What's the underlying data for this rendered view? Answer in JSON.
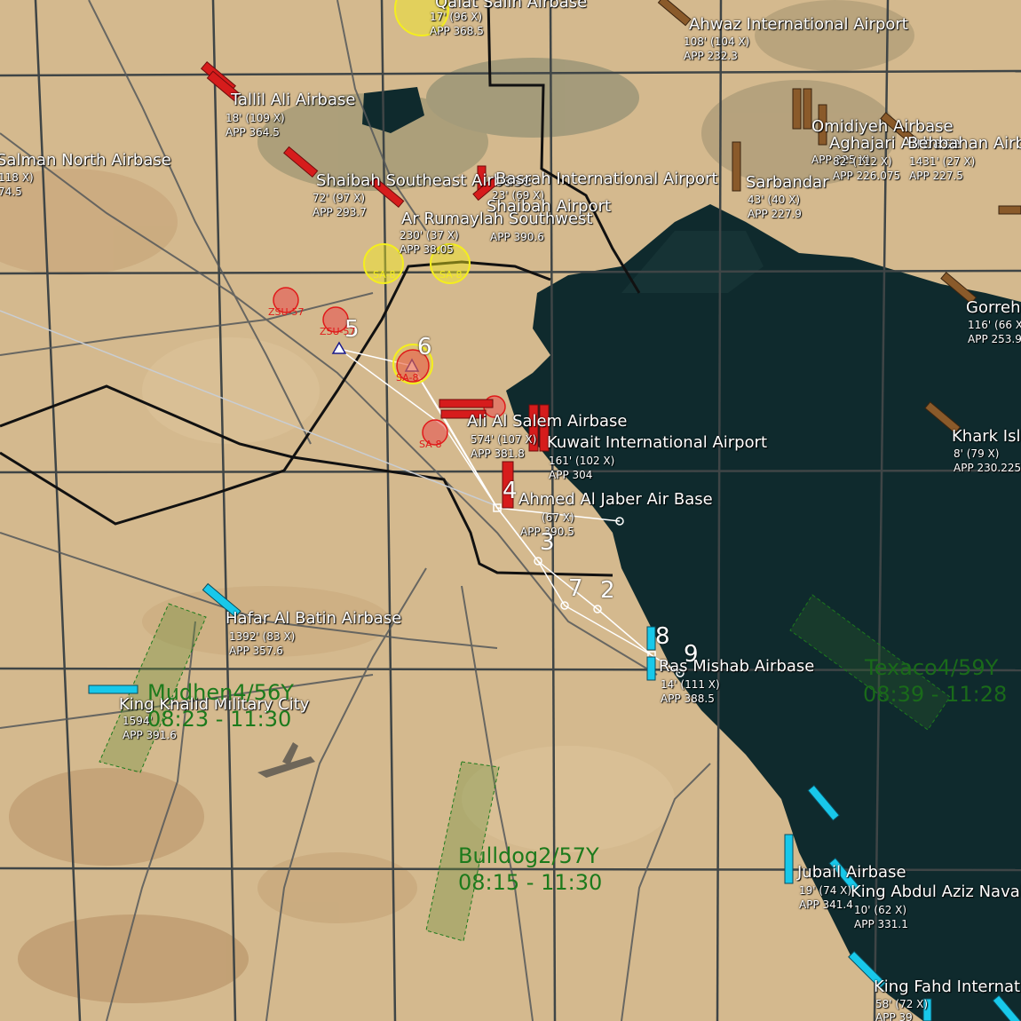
{
  "map": {
    "colors": {
      "land": "#d4b98e",
      "sea": "#0f2a2d",
      "grid": "#3f4546",
      "route": "#ffffff",
      "threat": "#e01a1a",
      "friendly": "#18c8ea",
      "hostile_airbase": "#d61c1c",
      "neutral_airbase": "#8a5a2a",
      "tanker": "#1c7a1c",
      "sam_yellow": "#f4ee1e"
    },
    "airbases": [
      {
        "name": "Salman North Airbase",
        "info1": "118 X)",
        "info2": "74.5"
      },
      {
        "name": "Tallil Ali Airbase",
        "info1": "18' (109 X)",
        "info2": "APP 364.5"
      },
      {
        "name": "Qalat Salih Airbase",
        "info1": "17' (96 X)",
        "info2": "APP 368.5"
      },
      {
        "name": "Ahwaz International Airport",
        "info1": "108' (104 X)",
        "info2": "APP 232.3"
      },
      {
        "name": "Shaibah Southeast Airbase",
        "info1": "72' (97 X)",
        "info2": "APP 293.7"
      },
      {
        "name": "Basrah International Airport",
        "info1": "23' (69 X)",
        "info2": ""
      },
      {
        "name": "Shaibah Airport",
        "info1": "",
        "info2": "APP 390.6"
      },
      {
        "name": "Ar Rumaylah Southwest",
        "info1": "230' (37 X)",
        "info2": "APP 38.05"
      },
      {
        "name": "Sarbandar",
        "info1": "43' (40 X)",
        "info2": "APP 227.9"
      },
      {
        "name": "Omidiyeh Airbase",
        "info1": "APP 225 X)",
        "info2": ""
      },
      {
        "name": "Aghajari Airbase",
        "info1": "82' (112 X)",
        "info2": "APP 226.075"
      },
      {
        "name": "Behbahan Airbase",
        "info1": "1431' (27 X)",
        "info2": "APP 227.5"
      },
      {
        "name": "Gorreh",
        "info1": "116' (66 X)",
        "info2": "APP 253.9"
      },
      {
        "name": "Khark Island",
        "info1": "8' (79 X)",
        "info2": "APP 230.225"
      },
      {
        "name": "Ali Al Salem Airbase",
        "info1": "574' (107 X)",
        "info2": "APP 381.8"
      },
      {
        "name": "Kuwait International Airport",
        "info1": "161' (102 X)",
        "info2": "APP 304"
      },
      {
        "name": "Ahmed Al Jaber Air Base",
        "info1": "(67 X)",
        "info2": "APP 390.5"
      },
      {
        "name": "Hafar Al Batin Airbase",
        "info1": "1392' (83 X)",
        "info2": "APP 357.6"
      },
      {
        "name": "King Khalid Military City",
        "info1": "1594'",
        "info2": "APP 391.6"
      },
      {
        "name": "Ras Mishab Airbase",
        "info1": "14' (111 X)",
        "info2": "APP 388.5"
      },
      {
        "name": "Jubail Airbase",
        "info1": "19' (74 X)",
        "info2": "APP 341.4"
      },
      {
        "name": "King Abdul Aziz Naval Base",
        "info1": "10' (62 X)",
        "info2": "APP 331.1"
      },
      {
        "name": "King Fahd International",
        "info1": "58' (72 X)",
        "info2": "APP 39"
      }
    ],
    "waypoints": [
      "2",
      "3",
      "4",
      "5",
      "6",
      "7",
      "8",
      "9"
    ],
    "threats": [
      "ZSU-57",
      "ZSU-57",
      "SA-8",
      "SA-8",
      "SA-8",
      "SA-8"
    ],
    "orbits": [
      {
        "callsign": "Mudhen4/56Y",
        "time": "08:23 - 11:30"
      },
      {
        "callsign": "Bulldog2/57Y",
        "time": "08:15 - 11:30"
      },
      {
        "callsign": "Texaco4/59Y",
        "time": "08:39 - 11:28"
      }
    ]
  }
}
